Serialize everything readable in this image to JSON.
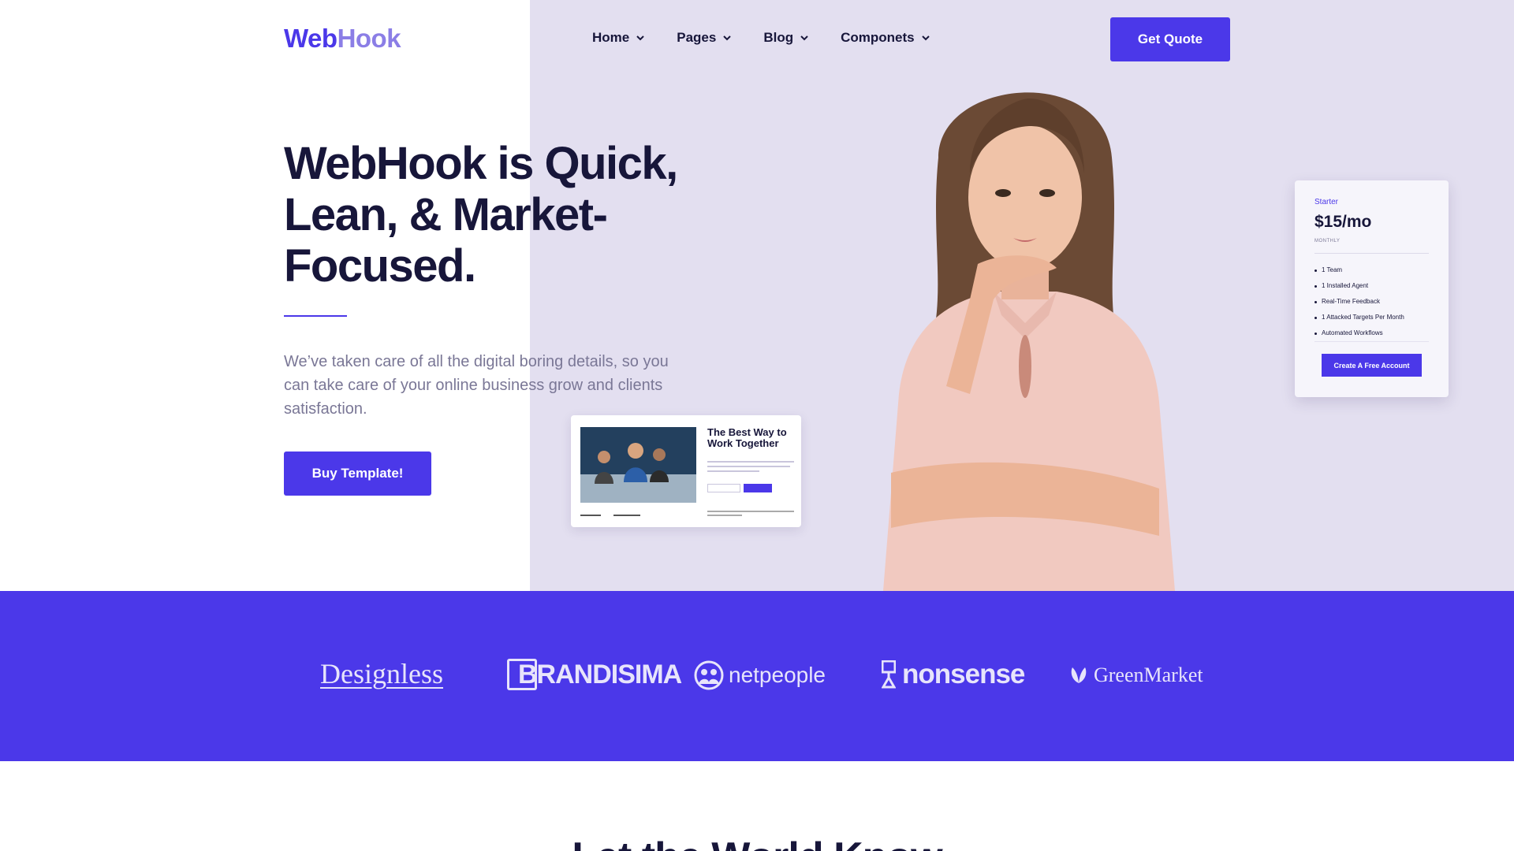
{
  "brand": {
    "logo_part1": "Web",
    "logo_part2": "Hook"
  },
  "nav": {
    "items": [
      {
        "label": "Home"
      },
      {
        "label": "Pages"
      },
      {
        "label": "Blog"
      },
      {
        "label": "Componets"
      }
    ],
    "cta_label": "Get Quote"
  },
  "hero": {
    "title": "WebHook is Quick, Lean, & Market-Focused.",
    "subtitle": "We’ve taken care of all the digital boring details, so you can take care of your online business grow and clients satisfaction.",
    "button_label": "Buy Template!"
  },
  "mini_card": {
    "title": "The Best Way to Work Together"
  },
  "pricing": {
    "plan": "Starter",
    "price": "$15/mo",
    "period": "MONTHLY",
    "features": [
      "1 Team",
      "1 Installed Agent",
      "Real-Time Feedback",
      "1 Attacked Targets Per Month",
      "Automated Workflows"
    ],
    "button_label": "Create A Free Account"
  },
  "brands": {
    "items": [
      "Designless",
      "BRANDISIMA",
      "netpeople",
      "nonsense",
      "GreenMarket"
    ]
  },
  "next_section": {
    "heading": "Let the World Know"
  },
  "colors": {
    "accent": "#4b38e9",
    "accent_light": "#8b7ee6",
    "hero_bg": "#e3dff0",
    "text_dark": "#17163a"
  }
}
